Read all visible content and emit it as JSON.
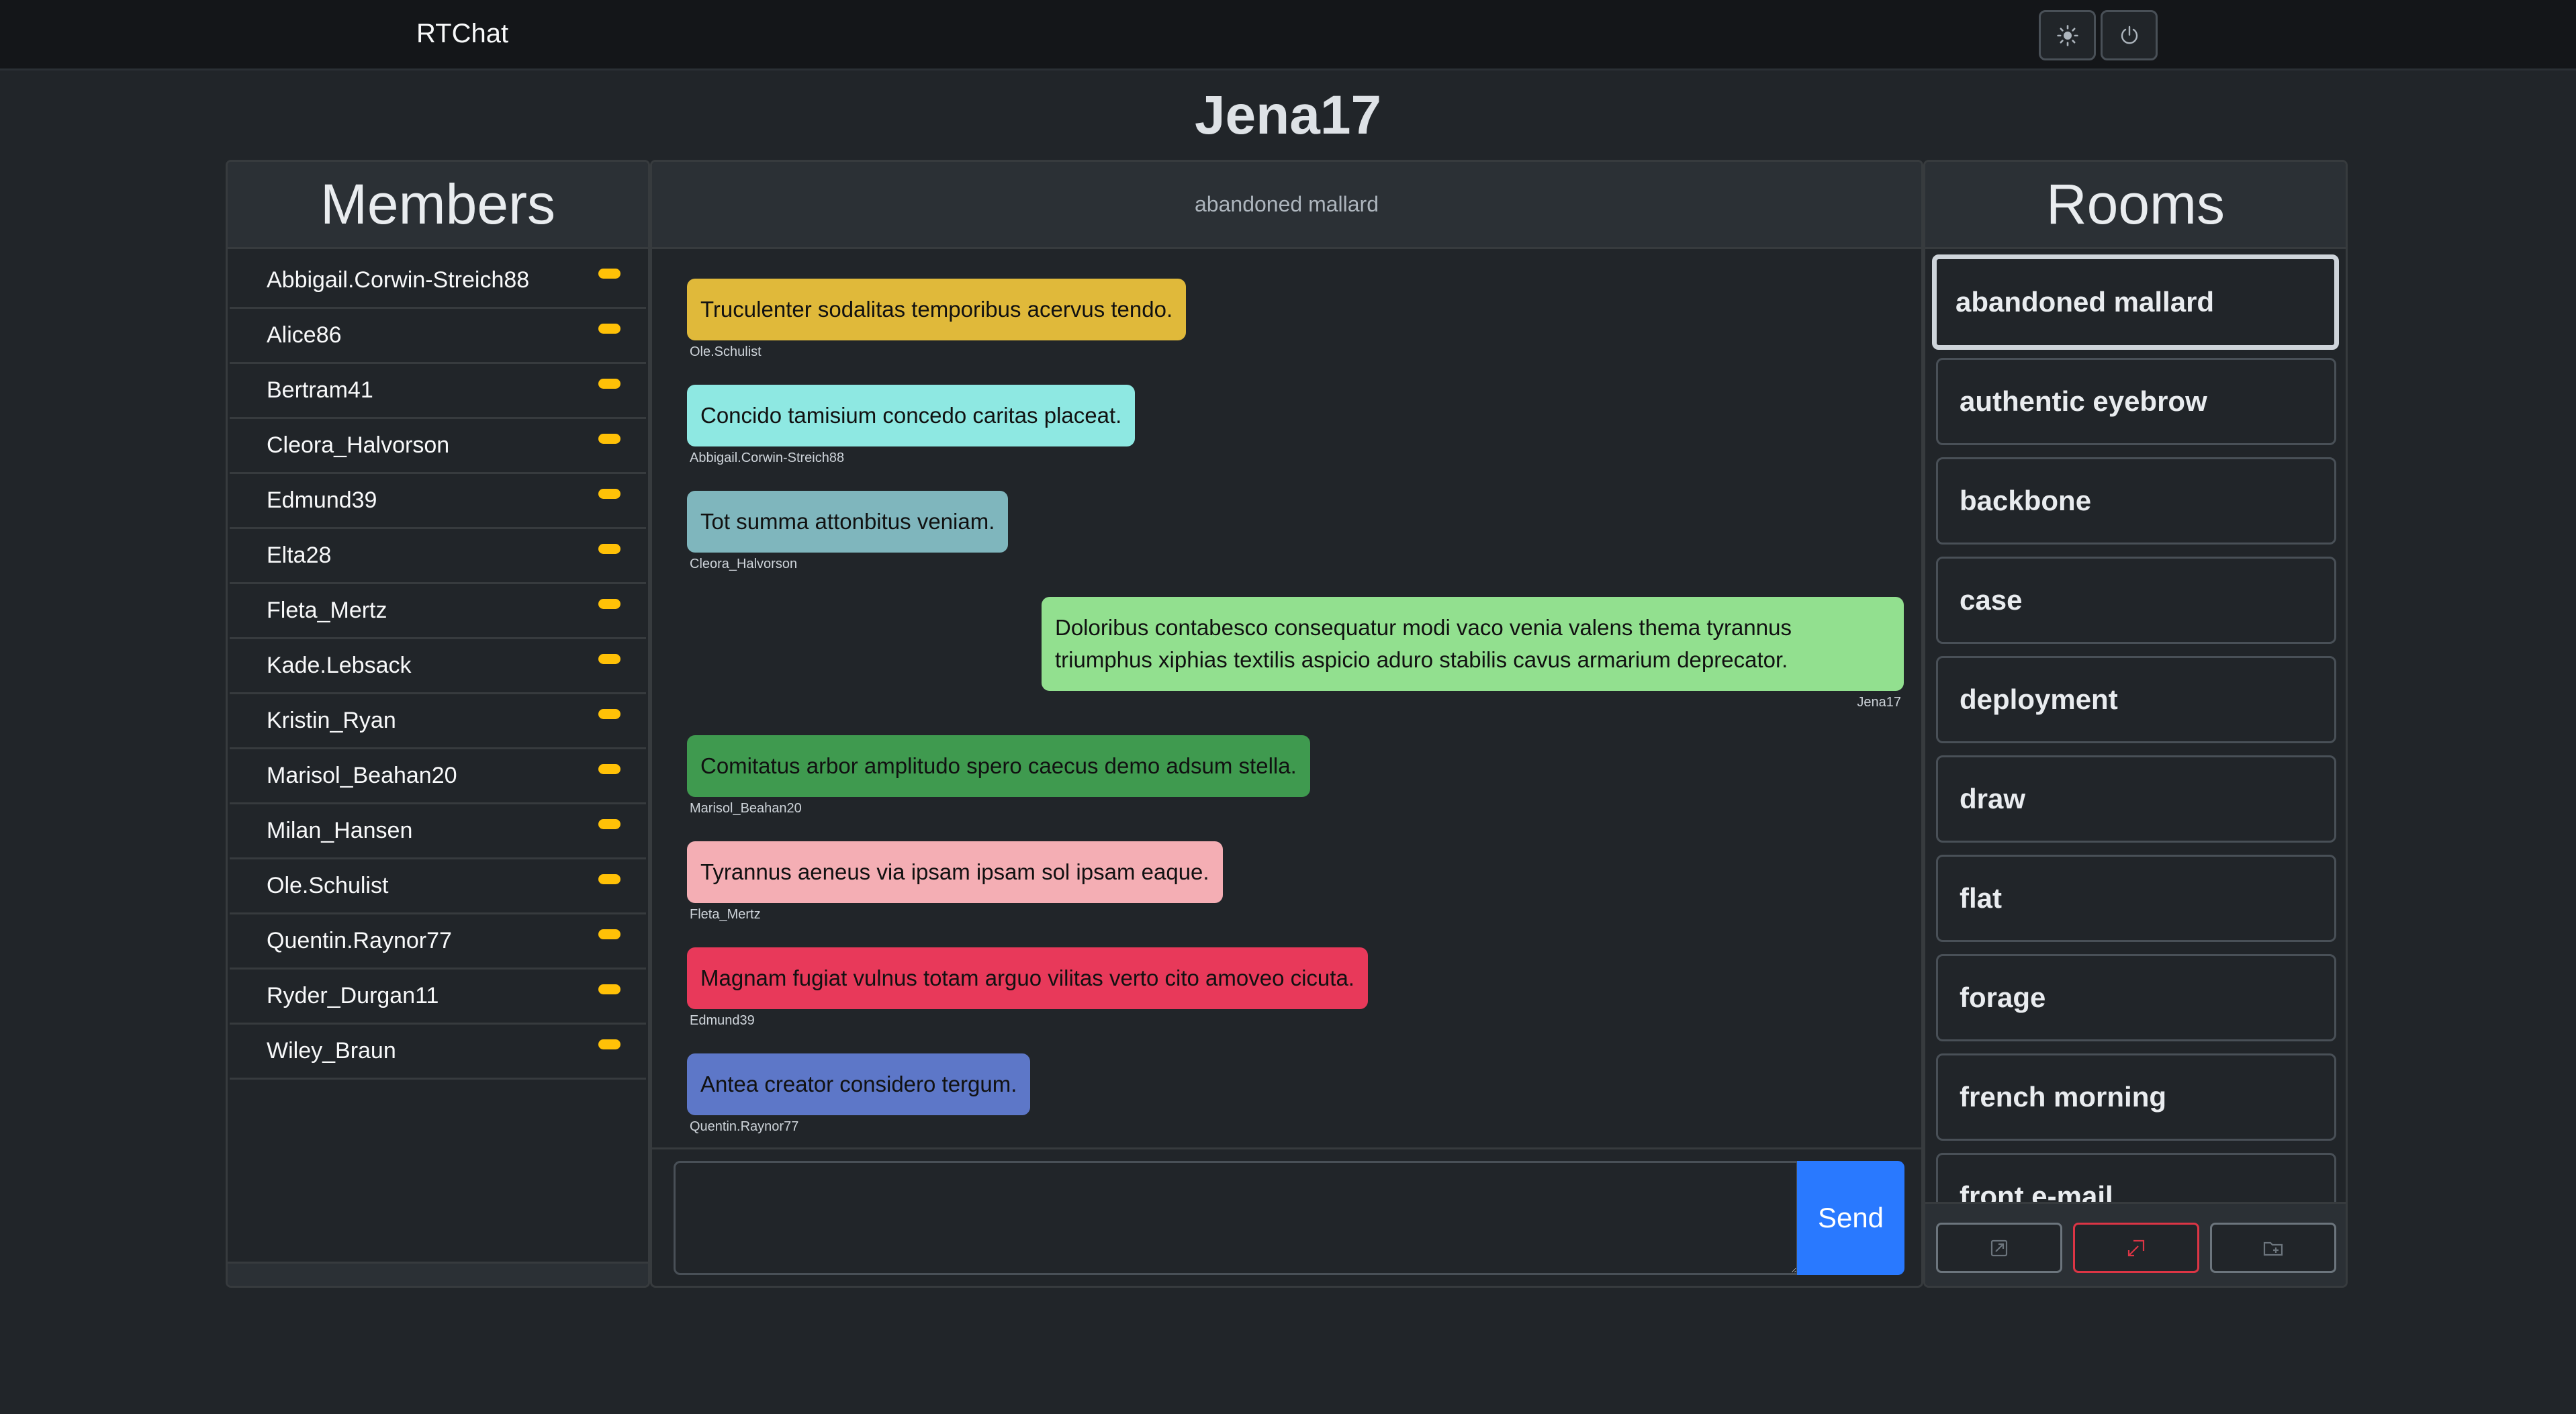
{
  "navbar": {
    "brand": "RTChat"
  },
  "page": {
    "title": "Jena17"
  },
  "members": {
    "title": "Members",
    "items": [
      {
        "name": "Abbigail.Corwin-Streich88"
      },
      {
        "name": "Alice86"
      },
      {
        "name": "Bertram41"
      },
      {
        "name": "Cleora_Halvorson"
      },
      {
        "name": "Edmund39"
      },
      {
        "name": "Elta28"
      },
      {
        "name": "Fleta_Mertz"
      },
      {
        "name": "Kade.Lebsack"
      },
      {
        "name": "Kristin_Ryan"
      },
      {
        "name": "Marisol_Beahan20"
      },
      {
        "name": "Milan_Hansen"
      },
      {
        "name": "Ole.Schulist"
      },
      {
        "name": "Quentin.Raynor77"
      },
      {
        "name": "Ryder_Durgan11"
      },
      {
        "name": "Wiley_Braun"
      }
    ],
    "status_color": "#ffc107"
  },
  "chat": {
    "room_name": "abandoned mallard",
    "messages": [
      {
        "text": "Truculenter sodalitas temporibus acervus tendo.",
        "author": "Ole.Schulist",
        "color": "#e0b93a",
        "side": "left"
      },
      {
        "text": "Concido tamisium concedo caritas placeat.",
        "author": "Abbigail.Corwin-Streich88",
        "color": "#8ee8e2",
        "side": "left"
      },
      {
        "text": "Tot summa attonbitus veniam.",
        "author": "Cleora_Halvorson",
        "color": "#7fb6bd",
        "side": "left"
      },
      {
        "text": "Doloribus contabesco consequatur modi vaco venia valens thema tyrannus triumphus xiphias textilis aspicio aduro stabilis cavus armarium deprecator.",
        "author": "Jena17",
        "color": "#92e08f",
        "side": "right"
      },
      {
        "text": "Comitatus arbor amplitudo spero caecus demo adsum stella.",
        "author": "Marisol_Beahan20",
        "color": "#3f9a4f",
        "side": "left"
      },
      {
        "text": "Tyrannus aeneus via ipsam ipsam sol ipsam eaque.",
        "author": "Fleta_Mertz",
        "color": "#f4aeb4",
        "side": "left"
      },
      {
        "text": "Magnam fugiat vulnus totam arguo vilitas verto cito amoveo cicuta.",
        "author": "Edmund39",
        "color": "#e8395a",
        "side": "left"
      },
      {
        "text": "Antea creator considero tergum.",
        "author": "Quentin.Raynor77",
        "color": "#5d77c8",
        "side": "left"
      }
    ],
    "input_value": "",
    "send_label": "Send"
  },
  "rooms": {
    "title": "Rooms",
    "items": [
      {
        "name": "abandoned mallard",
        "active": true
      },
      {
        "name": "authentic eyebrow"
      },
      {
        "name": "backbone"
      },
      {
        "name": "case"
      },
      {
        "name": "deployment"
      },
      {
        "name": "draw"
      },
      {
        "name": "flat"
      },
      {
        "name": "forage"
      },
      {
        "name": "french morning"
      },
      {
        "name": "front e-mail"
      }
    ]
  },
  "icons": {
    "theme": "sun-icon",
    "logout": "power-icon",
    "join": "box-arrow-in-icon",
    "leave": "box-arrow-out-icon",
    "new_room": "folder-plus-icon"
  }
}
